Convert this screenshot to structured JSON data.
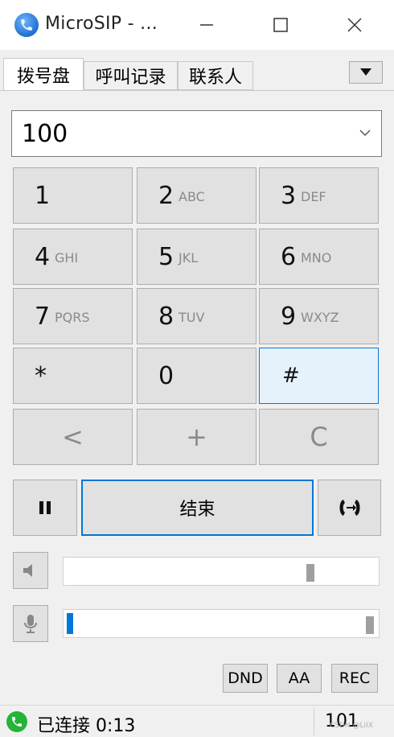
{
  "window": {
    "title": "MicroSIP - ..."
  },
  "tabs": [
    {
      "label": "拨号盘"
    },
    {
      "label": "呼叫记录"
    },
    {
      "label": "联系人"
    }
  ],
  "dial": {
    "number": "100"
  },
  "keypad": [
    {
      "digit": "1",
      "letters": ""
    },
    {
      "digit": "2",
      "letters": "ABC"
    },
    {
      "digit": "3",
      "letters": "DEF"
    },
    {
      "digit": "4",
      "letters": "GHI"
    },
    {
      "digit": "5",
      "letters": "JKL"
    },
    {
      "digit": "6",
      "letters": "MNO"
    },
    {
      "digit": "7",
      "letters": "PQRS"
    },
    {
      "digit": "8",
      "letters": "TUV"
    },
    {
      "digit": "9",
      "letters": "WXYZ"
    },
    {
      "digit": "*",
      "letters": ""
    },
    {
      "digit": "0",
      "letters": ""
    },
    {
      "digit": "#",
      "letters": ""
    }
  ],
  "edit_keys": {
    "backspace": "<",
    "plus": "+",
    "clear": "C"
  },
  "call": {
    "end_label": "结束"
  },
  "volume": {
    "speaker_level": 0.79,
    "mic_level": 0.02
  },
  "buttons": {
    "dnd": "DND",
    "aa": "AA",
    "rec": "REC"
  },
  "status": {
    "text": "已连接 0:13",
    "extension": "101",
    "watermark": "CSDN @LiIX"
  },
  "colors": {
    "accent": "#0078d7",
    "connected": "#25b33a"
  }
}
